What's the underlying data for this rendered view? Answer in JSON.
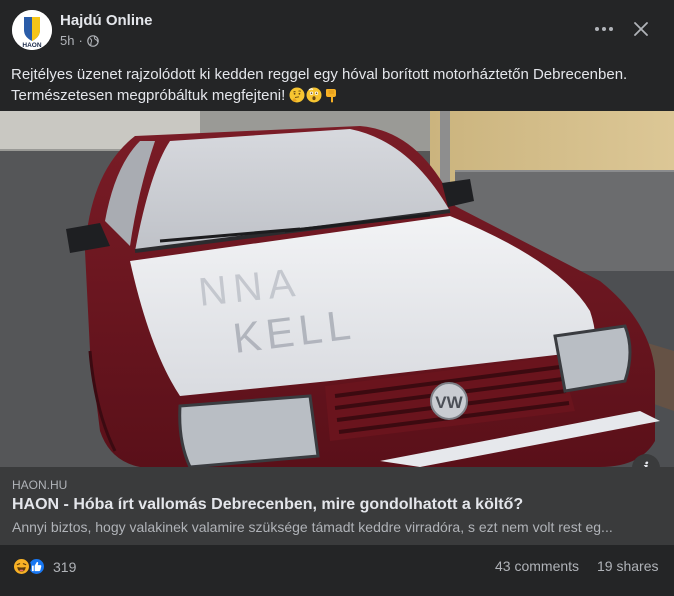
{
  "header": {
    "page_name": "Hajdú Online",
    "time": "5h",
    "separator": "·",
    "avatar_text": "HAON"
  },
  "post": {
    "text": "Rejtélyes üzenet rajzolódott ki kedden reggel egy hóval borított motorháztetőn Debrecenben. Természetesen megpróbáltuk megfejteni!",
    "emojis": [
      "thinking-face-icon",
      "astonished-face-icon",
      "pointing-down-icon"
    ]
  },
  "image": {
    "snow_text_line1": "NNA",
    "snow_text_line2": "KELL"
  },
  "link": {
    "domain": "HAON.HU",
    "title": "HAON - Hóba írt vallomás Debrecenben, mire gondolhatott a költő?",
    "description": "Annyi biztos, hogy valakinek valamire szüksége támadt keddre virradóra, s ezt nem volt rest eg..."
  },
  "stats": {
    "reaction_count": "319",
    "comments": "43 comments",
    "shares": "19 shares",
    "reactions": [
      "haha-icon",
      "like-icon"
    ]
  },
  "colors": {
    "background": "#242526",
    "link_box": "#3a3b3c",
    "text_primary": "#e4e6eb",
    "text_secondary": "#b0b3b8",
    "like_blue": "#1877f2",
    "haha_yellow": "#f7b125",
    "brand_yellow": "#f5c518",
    "brand_blue": "#2a5ca8"
  }
}
